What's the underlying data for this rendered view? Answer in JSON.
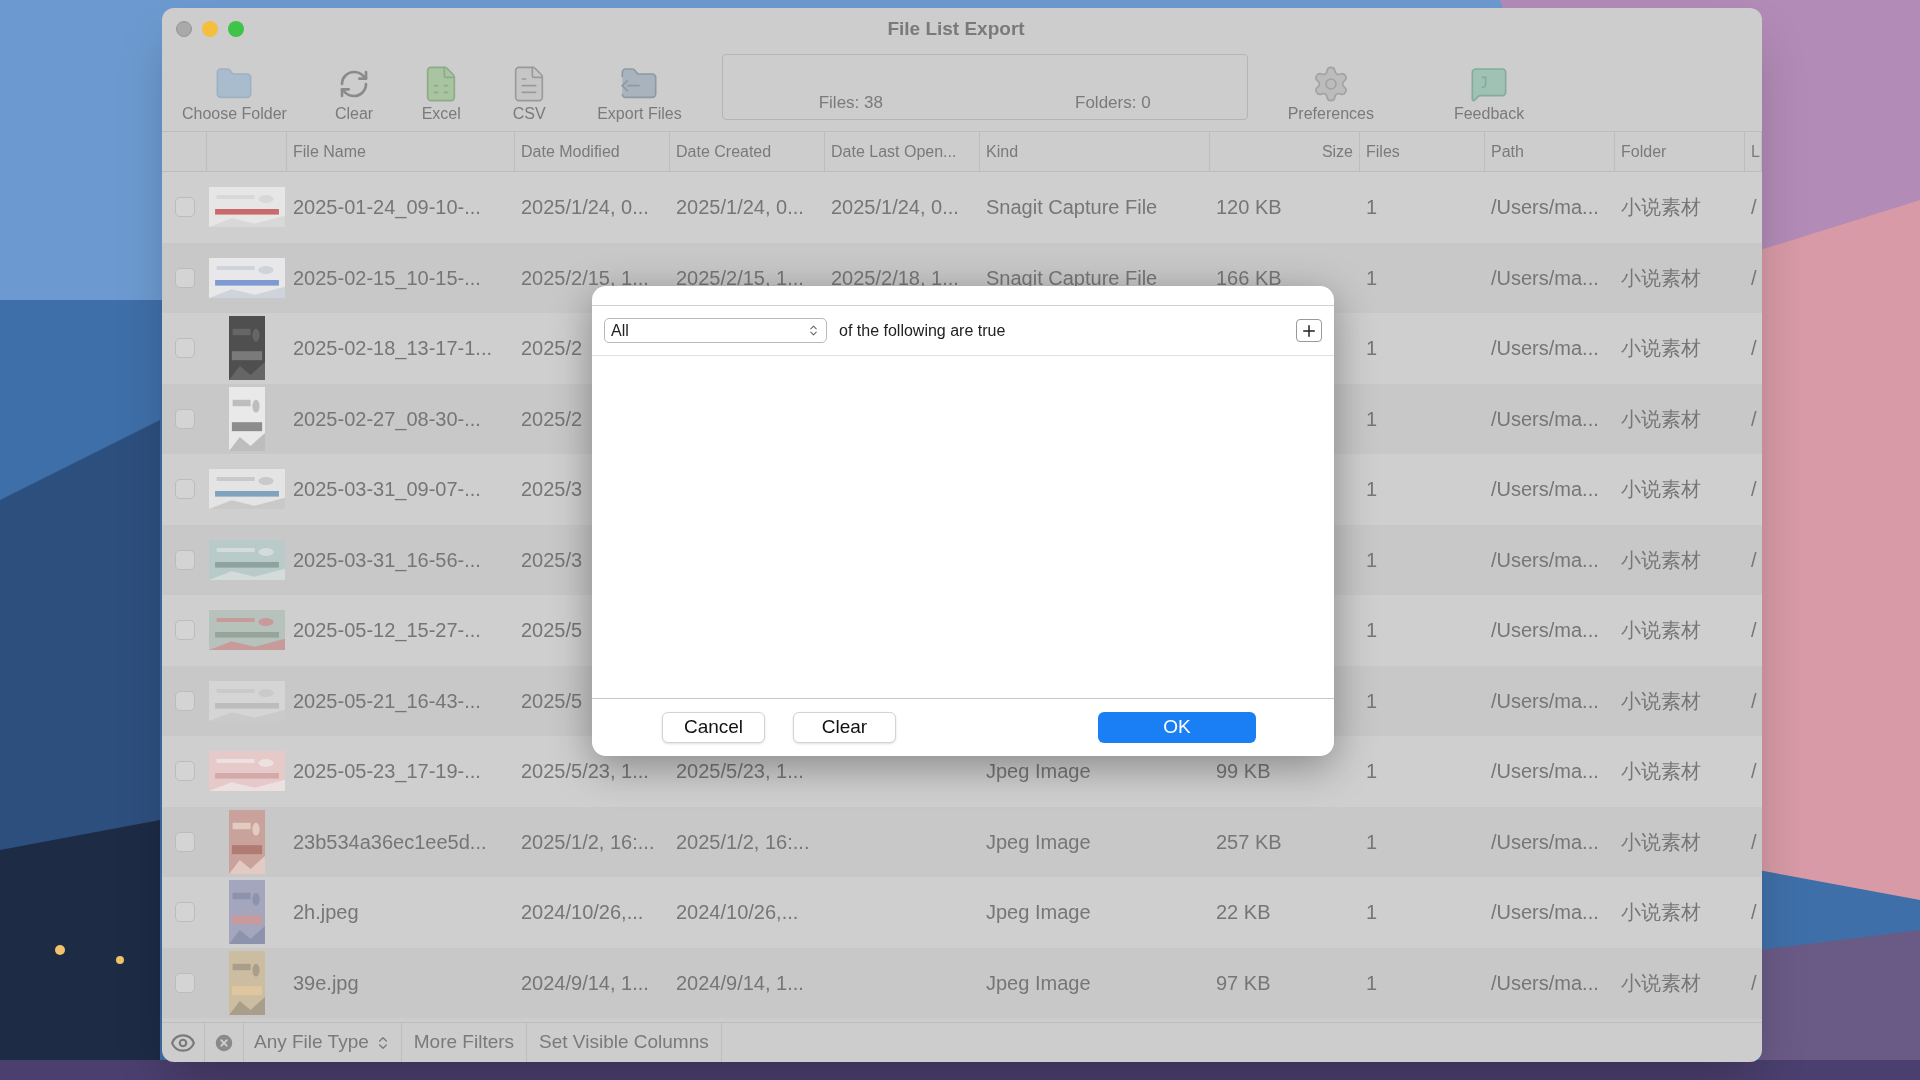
{
  "window": {
    "title": "File List Export"
  },
  "toolbar": {
    "left": [
      {
        "label": "Choose Folder",
        "kind": "folder"
      },
      {
        "label": "Clear",
        "kind": "refresh"
      },
      {
        "label": "Excel",
        "kind": "excel"
      },
      {
        "label": "CSV",
        "kind": "csv"
      },
      {
        "label": "Export Files",
        "kind": "export"
      }
    ],
    "stats": {
      "files": "Files: 38",
      "folders": "Folders: 0"
    },
    "right": [
      {
        "label": "Preferences",
        "kind": "gear"
      },
      {
        "label": "Feedback",
        "kind": "feedback"
      }
    ]
  },
  "table": {
    "columns": [
      "File Name",
      "Date Modified",
      "Date Created",
      "Date Last Open...",
      "Kind",
      "Size",
      "Files",
      "Path",
      "Folder",
      "L"
    ],
    "rows": [
      {
        "checked": false,
        "name": "2025-01-24_09-10-...",
        "date_modified": "2025/1/24, 0...",
        "date_created": "2025/1/24, 0...",
        "date_last_opened": "2025/1/24, 0...",
        "kind": "Snagit Capture File",
        "size": "120 KB",
        "files": "1",
        "path": "/Users/ma...",
        "folder": "小说素材",
        "column_10": "/"
      },
      {
        "checked": false,
        "name": "2025-02-15_10-15-...",
        "date_modified": "2025/2/15, 1...",
        "date_created": "2025/2/15, 1...",
        "date_last_opened": "2025/2/18, 1...",
        "kind": "Snagit Capture File",
        "size": "166 KB",
        "files": "1",
        "path": "/Users/ma...",
        "folder": "小说素材",
        "column_10": "/"
      },
      {
        "checked": false,
        "name": "2025-02-18_13-17-1...",
        "date_modified": "2025/2",
        "files": "1",
        "path": "/Users/ma...",
        "folder": "小说素材",
        "column_10": "/"
      },
      {
        "checked": false,
        "name": "2025-02-27_08-30-...",
        "date_modified": "2025/2",
        "files": "1",
        "path": "/Users/ma...",
        "folder": "小说素材",
        "column_10": "/"
      },
      {
        "checked": false,
        "name": "2025-03-31_09-07-...",
        "date_modified": "2025/3",
        "files": "1",
        "path": "/Users/ma...",
        "folder": "小说素材",
        "column_10": "/"
      },
      {
        "checked": false,
        "name": "2025-03-31_16-56-...",
        "date_modified": "2025/3",
        "files": "1",
        "path": "/Users/ma...",
        "folder": "小说素材",
        "column_10": "/"
      },
      {
        "checked": false,
        "name": "2025-05-12_15-27-...",
        "date_modified": "2025/5",
        "files": "1",
        "path": "/Users/ma...",
        "folder": "小说素材",
        "column_10": "/"
      },
      {
        "checked": false,
        "name": "2025-05-21_16-43-...",
        "date_modified": "2025/5",
        "files": "1",
        "path": "/Users/ma...",
        "folder": "小说素材",
        "column_10": "/"
      },
      {
        "checked": false,
        "name": "2025-05-23_17-19-...",
        "date_modified": "2025/5/23, 1...",
        "date_created": "2025/5/23, 1...",
        "kind": "Jpeg Image",
        "size": "99 KB",
        "files": "1",
        "path": "/Users/ma...",
        "folder": "小说素材",
        "column_10": "/"
      },
      {
        "checked": false,
        "name": "23b534a36ec1ee5d...",
        "date_modified": "2025/1/2, 16:...",
        "date_created": "2025/1/2, 16:...",
        "kind": "Jpeg Image",
        "size": "257 KB",
        "files": "1",
        "path": "/Users/ma...",
        "folder": "小说素材",
        "column_10": "/"
      },
      {
        "checked": false,
        "name": "2h.jpeg",
        "date_modified": "2024/10/26,...",
        "date_created": "2024/10/26,...",
        "kind": "Jpeg Image",
        "size": "22 KB",
        "files": "1",
        "path": "/Users/ma...",
        "folder": "小说素材",
        "column_10": "/"
      },
      {
        "checked": false,
        "name": "39e.jpg",
        "date_modified": "2024/9/14, 1...",
        "date_created": "2024/9/14, 1...",
        "kind": "Jpeg Image",
        "size": "97 KB",
        "files": "1",
        "path": "/Users/ma...",
        "folder": "小说素材",
        "column_10": "/"
      }
    ]
  },
  "bottom_bar": {
    "file_type": "Any File Type",
    "buttons": [
      "More Filters",
      "Set Visible Columns"
    ]
  },
  "dialog": {
    "match": "All",
    "text": "of the following are true",
    "buttons": [
      {
        "label": "Cancel",
        "kind": "default"
      },
      {
        "label": "Clear",
        "kind": "default"
      },
      {
        "label": "OK",
        "kind": "primary"
      }
    ]
  }
}
